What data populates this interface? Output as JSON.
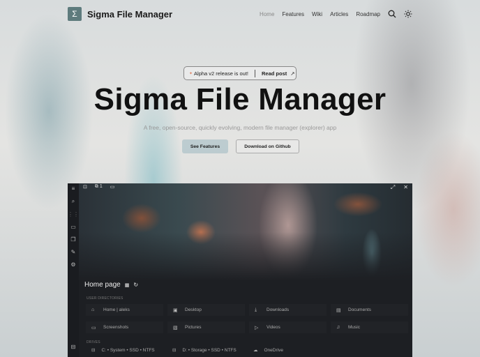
{
  "nav": {
    "logo_symbol": "Σ",
    "brand": "Sigma File Manager",
    "links": [
      "Home",
      "Features",
      "Wiki",
      "Articles",
      "Roadmap"
    ]
  },
  "announcement": {
    "text": "Alpha v2 release is out!",
    "link": "Read post"
  },
  "hero": {
    "title": "Sigma File Manager",
    "subtitle": "A free, open-source, quickly evolving, modern file manager (explorer) app",
    "primary": "See Features",
    "secondary": "Download on Github"
  },
  "app": {
    "tab_count": "1",
    "page_title": "Home page",
    "user_dirs_label": "USER DIRECTORIES",
    "user_dirs": [
      {
        "icon": "home-folder-icon",
        "label": "Home | aleks"
      },
      {
        "icon": "desktop-icon",
        "label": "Desktop"
      },
      {
        "icon": "download-icon",
        "label": "Downloads"
      },
      {
        "icon": "documents-icon",
        "label": "Documents"
      },
      {
        "icon": "screenshot-icon",
        "label": "Screenshots"
      },
      {
        "icon": "pictures-icon",
        "label": "Pictures"
      },
      {
        "icon": "video-icon",
        "label": "Videos"
      },
      {
        "icon": "music-icon",
        "label": "Music"
      }
    ],
    "drives_label": "DRIVES",
    "drives": [
      "C: • System • SSD • NTFS",
      "D: • Storage • SSD • NTFS",
      "OneDrive"
    ]
  }
}
